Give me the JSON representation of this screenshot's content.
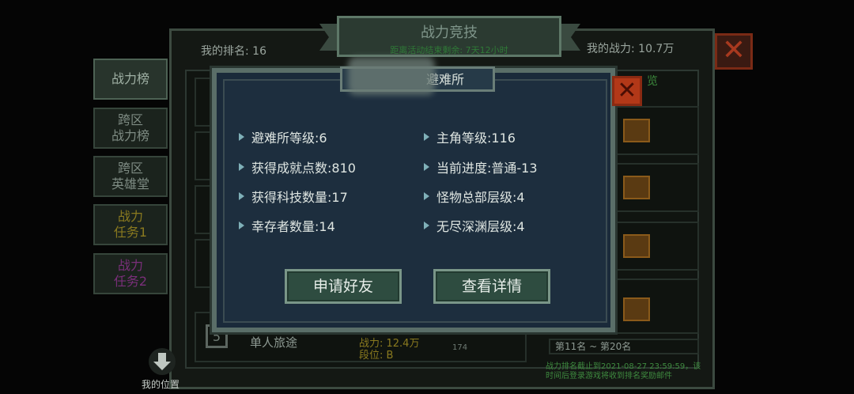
{
  "background": {
    "title": "战力竞技",
    "subtitle": "距离活动结束剩余: 7天12小时",
    "my_rank": "我的排名: 16",
    "my_power": "我的战力: 10.7万",
    "right_header_fragment": "览",
    "tabs": [
      {
        "label": "战力榜"
      },
      {
        "label": "跨区\n战力榜"
      },
      {
        "label": "跨区\n英雄堂"
      },
      {
        "label": "战力\n任务1"
      },
      {
        "label": "战力\n任务2"
      }
    ],
    "bottom_row": {
      "name": "单人旅途",
      "power": "战力: 12.4万",
      "tier": "段位: B",
      "count": "174",
      "rank_badge": "5"
    },
    "range_label": "第11名 ~ 第20名",
    "deadline_note": "战力排名截止到2021-08-27 23:59:59，该\n时间后登录游戏将收到排名奖励邮件",
    "nav_hint": "我的位置",
    "close_icon": "close-icon"
  },
  "modal": {
    "title": "避难所",
    "stats_left": [
      {
        "label": "避难所等级:6"
      },
      {
        "label": "获得成就点数:810"
      },
      {
        "label": "获得科技数量:17"
      },
      {
        "label": "幸存者数量:14"
      }
    ],
    "stats_right": [
      {
        "label": "主角等级:116"
      },
      {
        "label": "当前进度:普通-13"
      },
      {
        "label": "怪物总部层级:4"
      },
      {
        "label": "无尽深渊层级:4"
      }
    ],
    "add_friend_label": "申请好友",
    "view_details_label": "查看详情",
    "close_icon": "close-icon"
  }
}
